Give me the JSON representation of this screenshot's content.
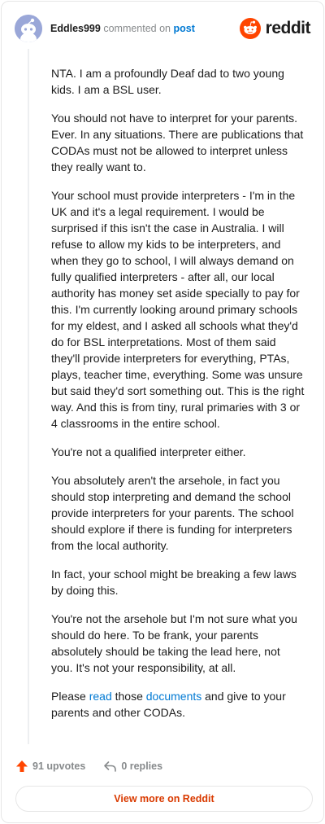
{
  "header": {
    "username": "Eddles999",
    "action_text": "commented on",
    "post_link": "post",
    "brand_name": "reddit",
    "brand_color": "#ff4500"
  },
  "comment": {
    "p1": "NTA. I am a profoundly Deaf dad to two young kids. I am a BSL user.",
    "p2": "You should not have to interpret for your parents. Ever. In any situations. There are publications that CODAs must not be allowed to interpret unless they really want to.",
    "p3": "Your school must provide interpreters - I'm in the UK and it's a legal requirement. I would be surprised if this isn't the case in Australia. I will refuse to allow my kids to be interpreters, and when they go to school, I will always demand on fully qualified interpreters - after all, our local authority has money set aside specially to pay for this. I'm currently looking around primary schools for my eldest, and I asked all schools what they'd do for BSL interpretations. Most of them said they'll provide interpreters for everything, PTAs, plays, teacher time, everything. Some was unsure but said they'd sort something out. This is the right way. And this is from tiny, rural primaries with 3 or 4 classrooms in the entire school.",
    "p4": "You're not a qualified interpreter either.",
    "p5": "You absolutely aren't the arsehole, in fact you should stop interpreting and demand the school provide interpreters for your parents. The school should explore if there is funding for interpreters from the local authority.",
    "p6": "In fact, your school might be breaking a few laws by doing this.",
    "p7": "You're not the arsehole but I'm not sure what you should do here. To be frank, your parents absolutely should be taking the lead here, not you. It's not your responsibility, at all.",
    "p8": {
      "t1": "Please ",
      "link1": "read",
      "t2": " those ",
      "link2": "documents",
      "t3": " and give to your parents and other CODAs."
    }
  },
  "footer": {
    "upvotes": "91 upvotes",
    "replies": "0 replies",
    "upvote_icon": "upvote-arrow-icon",
    "reply_icon": "reply-arrow-icon"
  },
  "cta": {
    "label": "View more on Reddit"
  }
}
